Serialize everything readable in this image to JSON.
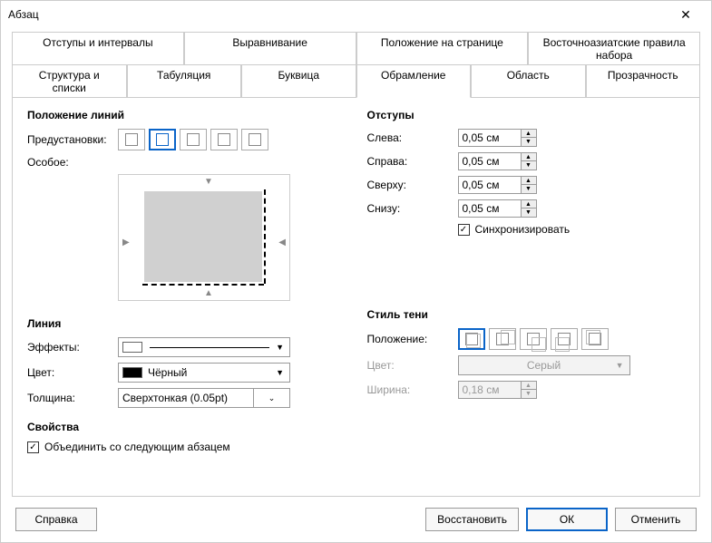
{
  "window": {
    "title": "Абзац"
  },
  "tabs": {
    "row1": [
      "Отступы и интервалы",
      "Выравнивание",
      "Положение на странице",
      "Восточноазиатские правила набора"
    ],
    "row2": [
      "Структура и списки",
      "Табуляция",
      "Буквица",
      "Обрамление",
      "Область",
      "Прозрачность"
    ],
    "active": "Обрамление"
  },
  "linePosition": {
    "title": "Положение линий",
    "presetsLabel": "Предустановки:",
    "customLabel": "Особое:"
  },
  "padding": {
    "title": "Отступы",
    "left": {
      "label": "Слева:",
      "value": "0,05 см"
    },
    "right": {
      "label": "Справа:",
      "value": "0,05 см"
    },
    "top": {
      "label": "Сверху:",
      "value": "0,05 см"
    },
    "bottom": {
      "label": "Снизу:",
      "value": "0,05 см"
    },
    "sync": "Синхронизировать"
  },
  "line": {
    "title": "Линия",
    "effectsLabel": "Эффекты:",
    "colorLabel": "Цвет:",
    "colorValue": "Чёрный",
    "widthLabel": "Толщина:",
    "widthValue": "Сверхтонкая (0.05pt)"
  },
  "shadow": {
    "title": "Стиль тени",
    "positionLabel": "Положение:",
    "colorLabel": "Цвет:",
    "colorValue": "Серый",
    "widthLabel": "Ширина:",
    "widthValue": "0,18 см"
  },
  "props": {
    "title": "Свойства",
    "merge": "Объединить со следующим абзацем"
  },
  "buttons": {
    "help": "Справка",
    "restore": "Восстановить",
    "ok": "ОК",
    "cancel": "Отменить"
  }
}
